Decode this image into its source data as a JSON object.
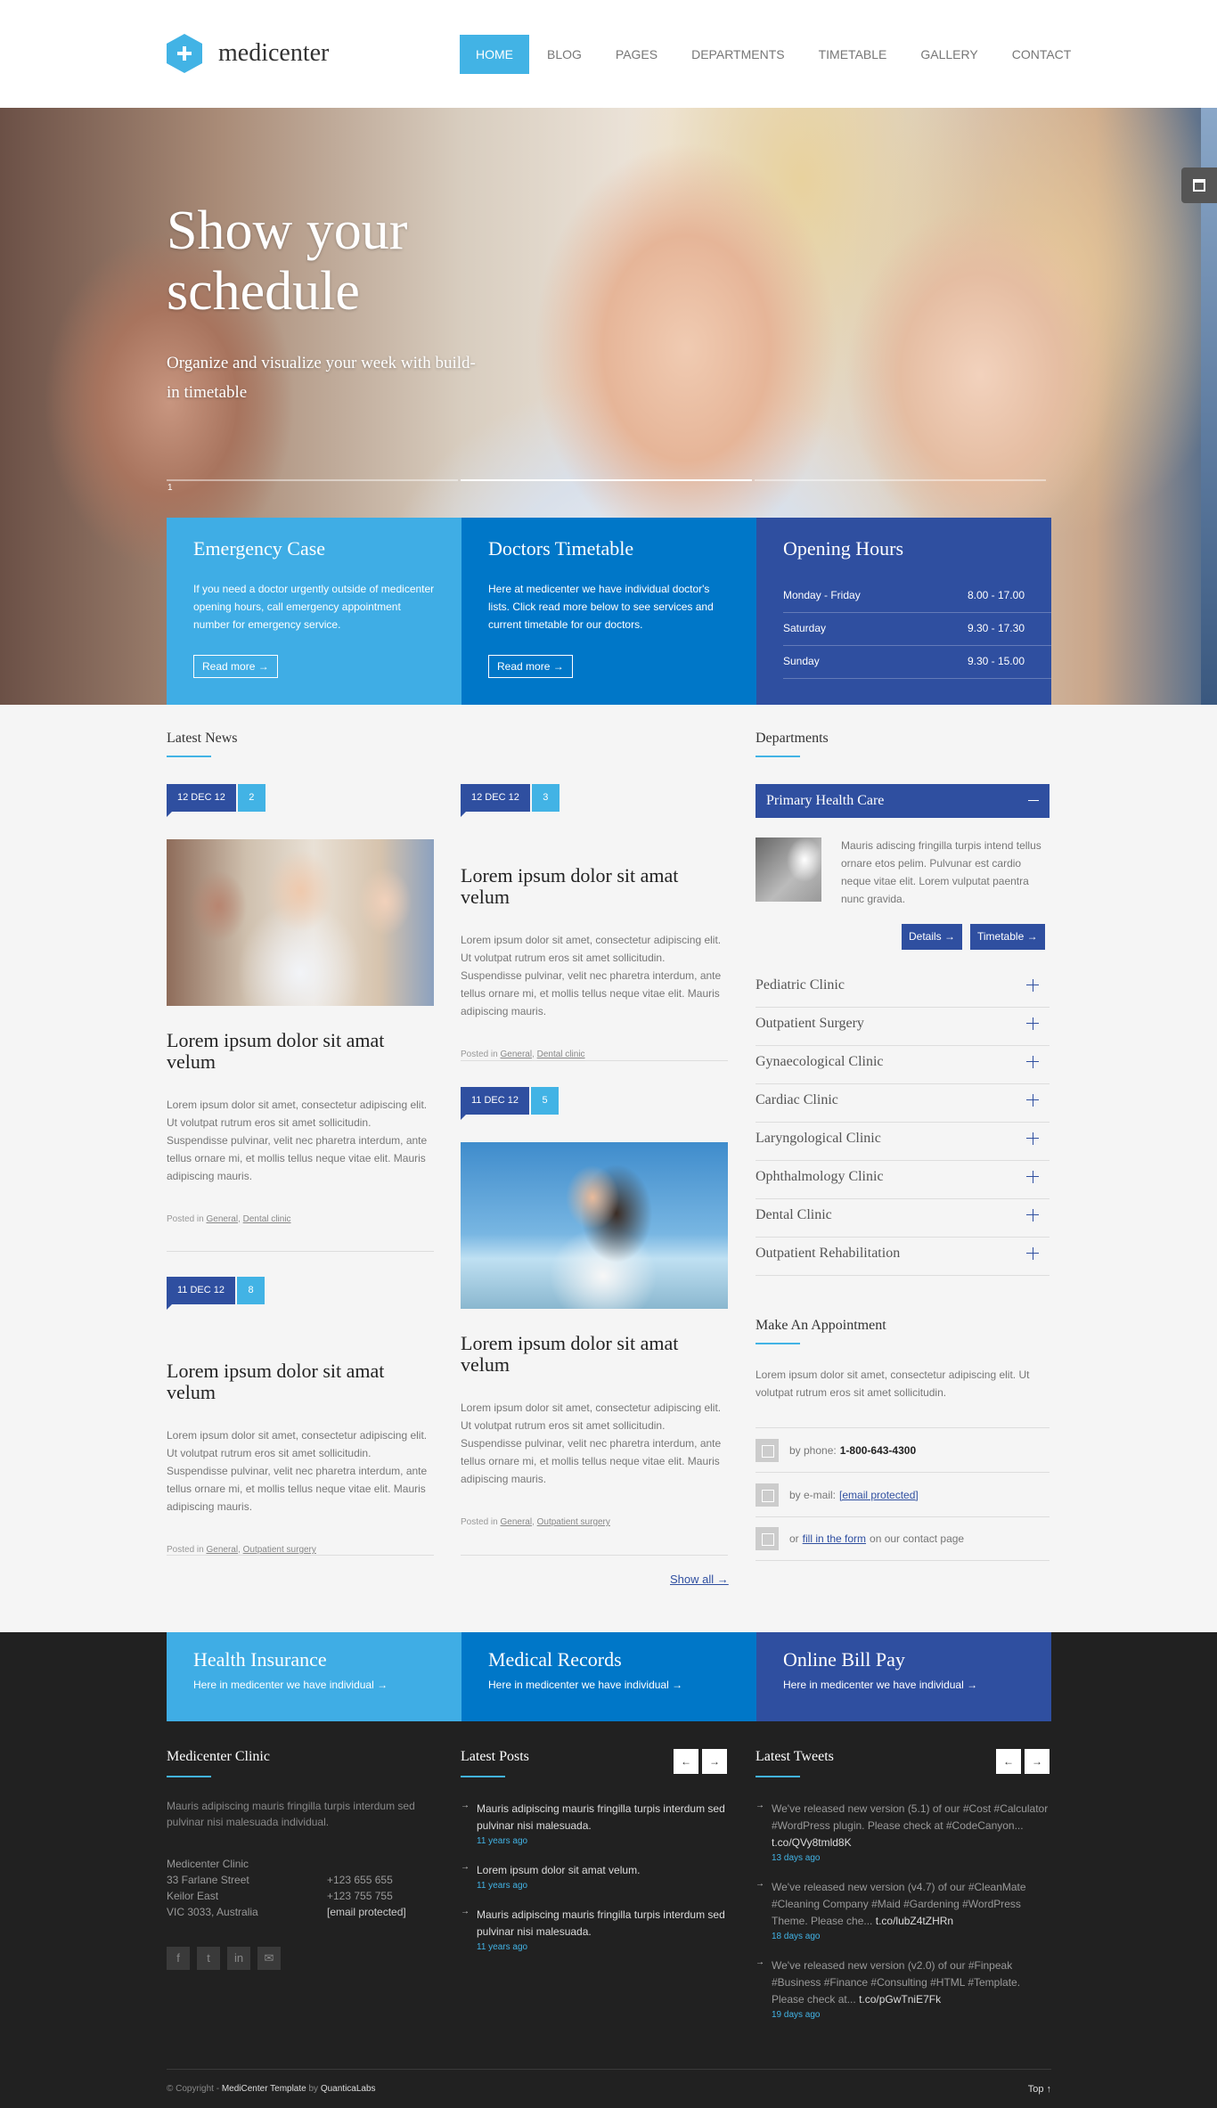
{
  "header": {
    "logo": "medicenter",
    "nav": [
      "HOME",
      "BLOG",
      "PAGES",
      "DEPARTMENTS",
      "TIMETABLE",
      "GALLERY",
      "CONTACT"
    ],
    "active": "HOME"
  },
  "hero": {
    "title": "Show your schedule",
    "subtitle": "Organize and visualize your week with build-in timetable",
    "slide_number": "1"
  },
  "boxes": {
    "emergency": {
      "title": "Emergency Case",
      "text": "If you need a doctor urgently outside of medicenter opening hours, call emergency appointment number for emergency service.",
      "button": "Read more →"
    },
    "timetable": {
      "title": "Doctors Timetable",
      "text": "Here at medicenter we have individual doctor's lists. Click read more below to see services and current timetable for our doctors.",
      "button": "Read more →"
    },
    "hours": {
      "title": "Opening Hours",
      "rows": [
        {
          "day": "Monday - Friday",
          "time": "8.00 - 17.00"
        },
        {
          "day": "Saturday",
          "time": "9.30 - 17.30"
        },
        {
          "day": "Sunday",
          "time": "9.30 - 15.00"
        }
      ]
    }
  },
  "news": {
    "title": "Latest News",
    "posts": [
      {
        "date": "12 DEC 12",
        "comments": "2",
        "title": "Lorem ipsum dolor sit amat velum",
        "text": "Lorem ipsum dolor sit amet, consectetur adipiscing elit. Ut volutpat rutrum eros sit amet sollicitudin. Suspendisse pulvinar, velit nec pharetra interdum, ante tellus ornare mi, et mollis tellus neque vitae elit. Mauris adipiscing mauris.",
        "posted_in": "Posted in",
        "cats": [
          "General",
          "Dental clinic"
        ]
      },
      {
        "date": "12 DEC 12",
        "comments": "3",
        "title": "Lorem ipsum dolor sit amat velum",
        "text": "Lorem ipsum dolor sit amet, consectetur adipiscing elit. Ut volutpat rutrum eros sit amet sollicitudin. Suspendisse pulvinar, velit nec pharetra interdum, ante tellus ornare mi, et mollis tellus neque vitae elit. Mauris adipiscing mauris.",
        "posted_in": "Posted in",
        "cats": [
          "General",
          "Dental clinic"
        ]
      },
      {
        "date": "11 DEC 12",
        "comments": "8",
        "title": "Lorem ipsum dolor sit amat velum",
        "text": "Lorem ipsum dolor sit amet, consectetur adipiscing elit. Ut volutpat rutrum eros sit amet sollicitudin. Suspendisse pulvinar, velit nec pharetra interdum, ante tellus ornare mi, et mollis tellus neque vitae elit. Mauris adipiscing mauris.",
        "posted_in": "Posted in",
        "cats": [
          "General",
          "Outpatient surgery"
        ]
      },
      {
        "date": "11 DEC 12",
        "comments": "5",
        "title": "Lorem ipsum dolor sit amat velum",
        "text": "Lorem ipsum dolor sit amet, consectetur adipiscing elit. Ut volutpat rutrum eros sit amet sollicitudin. Suspendisse pulvinar, velit nec pharetra interdum, ante tellus ornare mi, et mollis tellus neque vitae elit. Mauris adipiscing mauris.",
        "posted_in": "Posted in",
        "cats": [
          "General",
          "Outpatient surgery"
        ]
      }
    ],
    "show_all": "Show all →"
  },
  "departments": {
    "title": "Departments",
    "open": {
      "name": "Primary Health Care",
      "text": "Mauris adiscing fringilla turpis intend tellus ornare etos pelim. Pulvunar est cardio neque vitae elit. Lorem vulputat paentra nunc gravida.",
      "btn_details": "Details →",
      "btn_timetable": "Timetable →"
    },
    "items": [
      "Pediatric Clinic",
      "Outpatient Surgery",
      "Gynaecological Clinic",
      "Cardiac Clinic",
      "Laryngological Clinic",
      "Ophthalmology Clinic",
      "Dental Clinic",
      "Outpatient Rehabilitation"
    ]
  },
  "appointment": {
    "title": "Make An Appointment",
    "text": "Lorem ipsum dolor sit amet, consectetur adipiscing elit. Ut volutpat rutrum eros sit amet sollicitudin.",
    "phone_label": "by phone:",
    "phone": "1-800-643-4300",
    "email_label": "by e-mail:",
    "email": "[email protected]",
    "form_pre": "or",
    "form_link": "fill in the form",
    "form_post": "on our contact page"
  },
  "footer_boxes": [
    {
      "title": "Health Insurance",
      "text": "Here in medicenter we have individual →"
    },
    {
      "title": "Medical Records",
      "text": "Here in medicenter we have individual →"
    },
    {
      "title": "Online Bill Pay",
      "text": "Here in medicenter we have individual →"
    }
  ],
  "clinic": {
    "title": "Medicenter Clinic",
    "text": "Mauris adipiscing mauris fringilla turpis interdum sed pulvinar nisi malesuada individual.",
    "address": [
      "Medicenter Clinic",
      "33 Farlane Street",
      "Keilor East",
      "VIC 3033, Australia"
    ],
    "contact": [
      "+123 655 655",
      "+123 755 755",
      "[email protected]"
    ]
  },
  "latest_posts": {
    "title": "Latest Posts",
    "items": [
      {
        "text": "Mauris adipiscing mauris fringilla turpis interdum sed pulvinar nisi malesuada.",
        "ago": "11 years ago"
      },
      {
        "text": "Lorem ipsum dolor sit amat velum.",
        "ago": "11 years ago"
      },
      {
        "text": "Mauris adipiscing mauris fringilla turpis interdum sed pulvinar nisi malesuada.",
        "ago": "11 years ago"
      }
    ]
  },
  "latest_tweets": {
    "title": "Latest Tweets",
    "items": [
      {
        "text": "We've released new version (5.1) of our #Cost #Calculator #WordPress plugin. Please check at #CodeCanyon...",
        "link": "t.co/QVy8tmld8K",
        "ago": "13 days ago"
      },
      {
        "text": "We've released new version (v4.7) of our #CleanMate #Cleaning Company #Maid #Gardening #WordPress Theme. Please che...",
        "link": "t.co/lubZ4tZHRn",
        "ago": "18 days ago"
      },
      {
        "text": "We've released new version (v2.0) of our #Finpeak #Business #Finance #Consulting #HTML #Template. Please check at...",
        "link": "t.co/pGwTniE7Fk",
        "ago": "19 days ago"
      }
    ]
  },
  "copyright": {
    "pre": "© Copyright -",
    "template": "MediCenter Template",
    "by": "by",
    "author": "QuanticaLabs",
    "top": "Top ↑"
  }
}
